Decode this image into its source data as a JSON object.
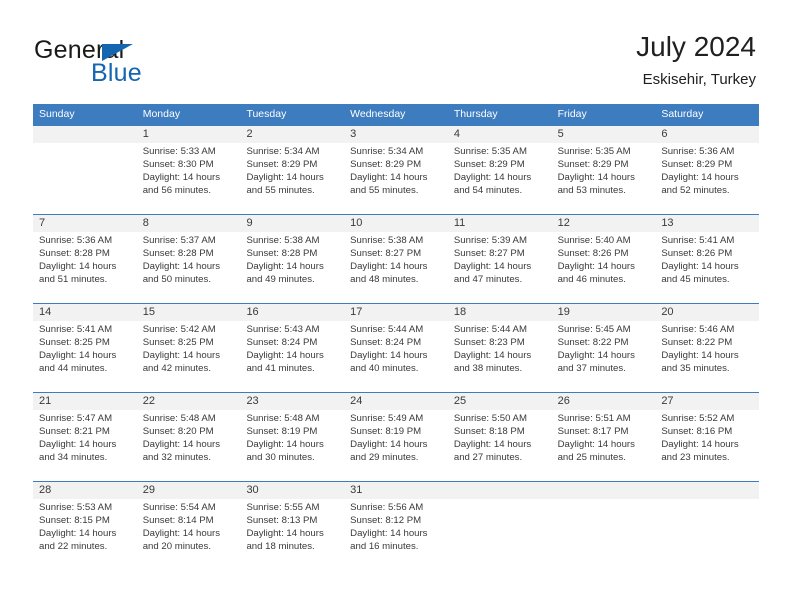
{
  "brand": {
    "name_part1": "General",
    "name_part2": "Blue",
    "accent_color": "#1565b0"
  },
  "header": {
    "title": "July 2024",
    "subtitle": "Eskisehir, Turkey"
  },
  "theme": {
    "header_row_color": "#3d7cbf",
    "daynum_band_color": "#f2f2f2",
    "text_color": "#3a3a3a"
  },
  "weekday_headers": [
    "Sunday",
    "Monday",
    "Tuesday",
    "Wednesday",
    "Thursday",
    "Friday",
    "Saturday"
  ],
  "weeks": [
    {
      "days": [
        {
          "num": "",
          "l1": "",
          "l2": "",
          "l3": "",
          "l4": ""
        },
        {
          "num": "1",
          "l1": "Sunrise: 5:33 AM",
          "l2": "Sunset: 8:30 PM",
          "l3": "Daylight: 14 hours",
          "l4": "and 56 minutes."
        },
        {
          "num": "2",
          "l1": "Sunrise: 5:34 AM",
          "l2": "Sunset: 8:29 PM",
          "l3": "Daylight: 14 hours",
          "l4": "and 55 minutes."
        },
        {
          "num": "3",
          "l1": "Sunrise: 5:34 AM",
          "l2": "Sunset: 8:29 PM",
          "l3": "Daylight: 14 hours",
          "l4": "and 55 minutes."
        },
        {
          "num": "4",
          "l1": "Sunrise: 5:35 AM",
          "l2": "Sunset: 8:29 PM",
          "l3": "Daylight: 14 hours",
          "l4": "and 54 minutes."
        },
        {
          "num": "5",
          "l1": "Sunrise: 5:35 AM",
          "l2": "Sunset: 8:29 PM",
          "l3": "Daylight: 14 hours",
          "l4": "and 53 minutes."
        },
        {
          "num": "6",
          "l1": "Sunrise: 5:36 AM",
          "l2": "Sunset: 8:29 PM",
          "l3": "Daylight: 14 hours",
          "l4": "and 52 minutes."
        }
      ]
    },
    {
      "days": [
        {
          "num": "7",
          "l1": "Sunrise: 5:36 AM",
          "l2": "Sunset: 8:28 PM",
          "l3": "Daylight: 14 hours",
          "l4": "and 51 minutes."
        },
        {
          "num": "8",
          "l1": "Sunrise: 5:37 AM",
          "l2": "Sunset: 8:28 PM",
          "l3": "Daylight: 14 hours",
          "l4": "and 50 minutes."
        },
        {
          "num": "9",
          "l1": "Sunrise: 5:38 AM",
          "l2": "Sunset: 8:28 PM",
          "l3": "Daylight: 14 hours",
          "l4": "and 49 minutes."
        },
        {
          "num": "10",
          "l1": "Sunrise: 5:38 AM",
          "l2": "Sunset: 8:27 PM",
          "l3": "Daylight: 14 hours",
          "l4": "and 48 minutes."
        },
        {
          "num": "11",
          "l1": "Sunrise: 5:39 AM",
          "l2": "Sunset: 8:27 PM",
          "l3": "Daylight: 14 hours",
          "l4": "and 47 minutes."
        },
        {
          "num": "12",
          "l1": "Sunrise: 5:40 AM",
          "l2": "Sunset: 8:26 PM",
          "l3": "Daylight: 14 hours",
          "l4": "and 46 minutes."
        },
        {
          "num": "13",
          "l1": "Sunrise: 5:41 AM",
          "l2": "Sunset: 8:26 PM",
          "l3": "Daylight: 14 hours",
          "l4": "and 45 minutes."
        }
      ]
    },
    {
      "days": [
        {
          "num": "14",
          "l1": "Sunrise: 5:41 AM",
          "l2": "Sunset: 8:25 PM",
          "l3": "Daylight: 14 hours",
          "l4": "and 44 minutes."
        },
        {
          "num": "15",
          "l1": "Sunrise: 5:42 AM",
          "l2": "Sunset: 8:25 PM",
          "l3": "Daylight: 14 hours",
          "l4": "and 42 minutes."
        },
        {
          "num": "16",
          "l1": "Sunrise: 5:43 AM",
          "l2": "Sunset: 8:24 PM",
          "l3": "Daylight: 14 hours",
          "l4": "and 41 minutes."
        },
        {
          "num": "17",
          "l1": "Sunrise: 5:44 AM",
          "l2": "Sunset: 8:24 PM",
          "l3": "Daylight: 14 hours",
          "l4": "and 40 minutes."
        },
        {
          "num": "18",
          "l1": "Sunrise: 5:44 AM",
          "l2": "Sunset: 8:23 PM",
          "l3": "Daylight: 14 hours",
          "l4": "and 38 minutes."
        },
        {
          "num": "19",
          "l1": "Sunrise: 5:45 AM",
          "l2": "Sunset: 8:22 PM",
          "l3": "Daylight: 14 hours",
          "l4": "and 37 minutes."
        },
        {
          "num": "20",
          "l1": "Sunrise: 5:46 AM",
          "l2": "Sunset: 8:22 PM",
          "l3": "Daylight: 14 hours",
          "l4": "and 35 minutes."
        }
      ]
    },
    {
      "days": [
        {
          "num": "21",
          "l1": "Sunrise: 5:47 AM",
          "l2": "Sunset: 8:21 PM",
          "l3": "Daylight: 14 hours",
          "l4": "and 34 minutes."
        },
        {
          "num": "22",
          "l1": "Sunrise: 5:48 AM",
          "l2": "Sunset: 8:20 PM",
          "l3": "Daylight: 14 hours",
          "l4": "and 32 minutes."
        },
        {
          "num": "23",
          "l1": "Sunrise: 5:48 AM",
          "l2": "Sunset: 8:19 PM",
          "l3": "Daylight: 14 hours",
          "l4": "and 30 minutes."
        },
        {
          "num": "24",
          "l1": "Sunrise: 5:49 AM",
          "l2": "Sunset: 8:19 PM",
          "l3": "Daylight: 14 hours",
          "l4": "and 29 minutes."
        },
        {
          "num": "25",
          "l1": "Sunrise: 5:50 AM",
          "l2": "Sunset: 8:18 PM",
          "l3": "Daylight: 14 hours",
          "l4": "and 27 minutes."
        },
        {
          "num": "26",
          "l1": "Sunrise: 5:51 AM",
          "l2": "Sunset: 8:17 PM",
          "l3": "Daylight: 14 hours",
          "l4": "and 25 minutes."
        },
        {
          "num": "27",
          "l1": "Sunrise: 5:52 AM",
          "l2": "Sunset: 8:16 PM",
          "l3": "Daylight: 14 hours",
          "l4": "and 23 minutes."
        }
      ]
    },
    {
      "days": [
        {
          "num": "28",
          "l1": "Sunrise: 5:53 AM",
          "l2": "Sunset: 8:15 PM",
          "l3": "Daylight: 14 hours",
          "l4": "and 22 minutes."
        },
        {
          "num": "29",
          "l1": "Sunrise: 5:54 AM",
          "l2": "Sunset: 8:14 PM",
          "l3": "Daylight: 14 hours",
          "l4": "and 20 minutes."
        },
        {
          "num": "30",
          "l1": "Sunrise: 5:55 AM",
          "l2": "Sunset: 8:13 PM",
          "l3": "Daylight: 14 hours",
          "l4": "and 18 minutes."
        },
        {
          "num": "31",
          "l1": "Sunrise: 5:56 AM",
          "l2": "Sunset: 8:12 PM",
          "l3": "Daylight: 14 hours",
          "l4": "and 16 minutes."
        },
        {
          "num": "",
          "l1": "",
          "l2": "",
          "l3": "",
          "l4": ""
        },
        {
          "num": "",
          "l1": "",
          "l2": "",
          "l3": "",
          "l4": ""
        },
        {
          "num": "",
          "l1": "",
          "l2": "",
          "l3": "",
          "l4": ""
        }
      ]
    }
  ]
}
